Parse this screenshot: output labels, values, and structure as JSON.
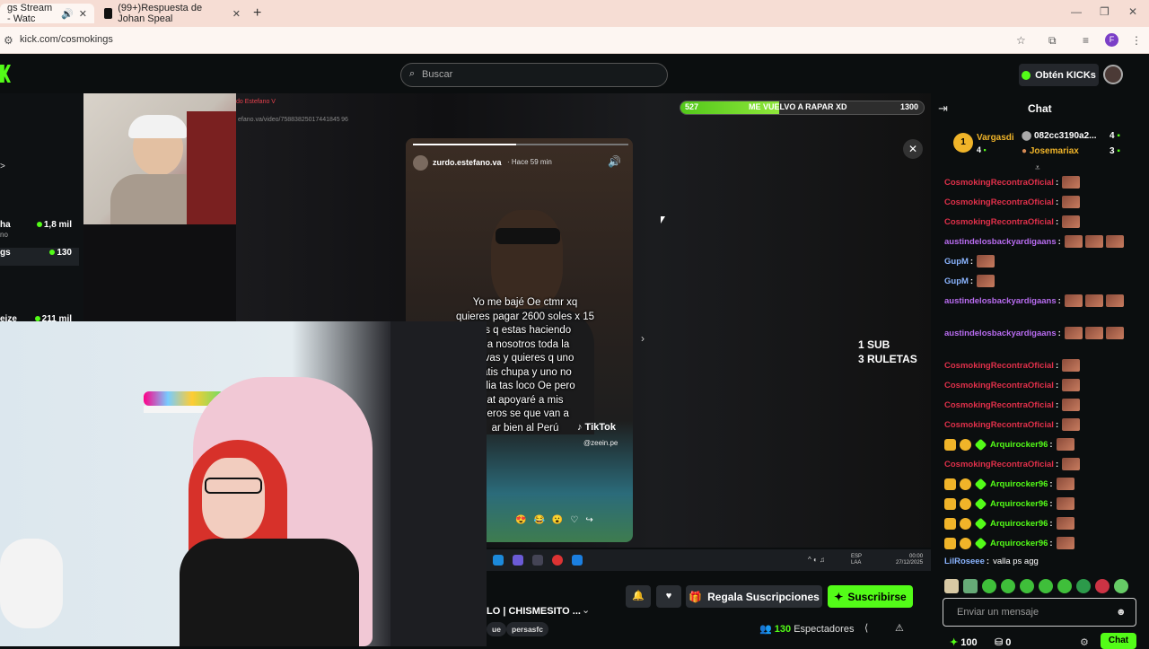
{
  "browser": {
    "tabs": [
      {
        "label": "gs Stream - Watc"
      },
      {
        "label": "(99+)Respuesta de Johan Speal"
      }
    ],
    "url": "kick.com/cosmokings"
  },
  "nav": {
    "search_placeholder": "Buscar",
    "kicks_label": "Obtén KICKs"
  },
  "sidebar": {
    "items": [
      {
        "name": "ha",
        "sub": "no",
        "count": "1,8 mil"
      },
      {
        "name": "gs",
        "sub": "",
        "count": "130"
      },
      {
        "name": "eize",
        "sub": "",
        "count": "211 mil"
      }
    ],
    "arrow": ">"
  },
  "stream": {
    "inner_tab": "do Estefano V",
    "inner_url": "efano.va/video/75883825017441845 96",
    "goal": {
      "start": "527",
      "label": "ME VUELVO A RAPAR XD",
      "end": "1300",
      "progress": 0.405
    },
    "tiktok": {
      "user": "zurdo.estefano.va",
      "time": "· Hace 59 min",
      "caption": "Yo me bajé Oe ctmr xq\nquieres pagar 2600 soles x 15\nes q estas haciendo\nr a nosotros toda la\nlevas y quieres q uno\nratis chupa y uno no\nmilia tas loco Oe pero\nat apoyaré a mis\nneros se que van a\nar bien al Perú",
      "brand": "♪ TikTok",
      "handle": "@zeein.pe"
    },
    "side_text_1": "1 SUB",
    "side_text_2": "3 RULETAS",
    "taskbar_lang": "ESP\nLAA",
    "taskbar_clock": "00:00\n27/12/2025"
  },
  "info": {
    "title": "LO | CHISMESITO ...",
    "tags": [
      "ue",
      "persasfc"
    ],
    "gift_label": "Regala Suscripciones",
    "subscribe_label": "Suscribirse",
    "viewers_count": "130",
    "viewers_label": "Espectadores"
  },
  "chat": {
    "title": "Chat",
    "pinned": {
      "user1": "Vargasdi",
      "user1_count": "4",
      "user2": "082cc3190a2...",
      "user2_count": "4",
      "user3": "Josemariax",
      "user3_count": "3",
      "user1_sub": "4"
    },
    "messages": [
      {
        "user": "CosmokingRecontraOficial",
        "color": "#e0304a",
        "emotes": 1,
        "badges": []
      },
      {
        "user": "CosmokingRecontraOficial",
        "color": "#e0304a",
        "emotes": 1,
        "badges": []
      },
      {
        "user": "CosmokingRecontraOficial",
        "color": "#e0304a",
        "emotes": 1,
        "badges": []
      },
      {
        "user": "austindelosbackyardigaans",
        "color": "#b86cf0",
        "emotes": 3,
        "badges": []
      },
      {
        "user": "GupM",
        "color": "#8ab4ff",
        "emotes": 1,
        "badges": []
      },
      {
        "user": "GupM",
        "color": "#8ab4ff",
        "emotes": 1,
        "badges": []
      },
      {
        "user": "austindelosbackyardigaans",
        "color": "#b86cf0",
        "emotes": 3,
        "badges": []
      },
      {
        "user": "austindelosbackyardigaans",
        "color": "#b86cf0",
        "emotes": 3,
        "badges": []
      },
      {
        "user": "CosmokingRecontraOficial",
        "color": "#e0304a",
        "emotes": 1,
        "badges": []
      },
      {
        "user": "CosmokingRecontraOficial",
        "color": "#e0304a",
        "emotes": 1,
        "badges": []
      },
      {
        "user": "CosmokingRecontraOficial",
        "color": "#e0304a",
        "emotes": 1,
        "badges": []
      },
      {
        "user": "CosmokingRecontraOficial",
        "color": "#e0304a",
        "emotes": 1,
        "badges": []
      },
      {
        "user": "Arquirocker96",
        "color": "#53fc18",
        "emotes": 1,
        "badges": [
          "crown",
          "one",
          "green"
        ]
      },
      {
        "user": "CosmokingRecontraOficial",
        "color": "#e0304a",
        "emotes": 1,
        "badges": []
      },
      {
        "user": "Arquirocker96",
        "color": "#53fc18",
        "emotes": 1,
        "badges": [
          "crown",
          "one",
          "green"
        ]
      },
      {
        "user": "Arquirocker96",
        "color": "#53fc18",
        "emotes": 1,
        "badges": [
          "crown",
          "one",
          "green"
        ]
      },
      {
        "user": "Arquirocker96",
        "color": "#53fc18",
        "emotes": 1,
        "badges": [
          "crown",
          "one",
          "green"
        ]
      },
      {
        "user": "Arquirocker96",
        "color": "#53fc18",
        "emotes": 1,
        "badges": [
          "crown",
          "one",
          "green"
        ]
      },
      {
        "user": "LilRoseee",
        "color": "#8ab4ff",
        "text": "valla ps agg",
        "emotes": 0,
        "badges": []
      }
    ],
    "input_placeholder": "Enviar un mensaje",
    "points_1": "100",
    "points_2": "0",
    "send_label": "Chat"
  }
}
